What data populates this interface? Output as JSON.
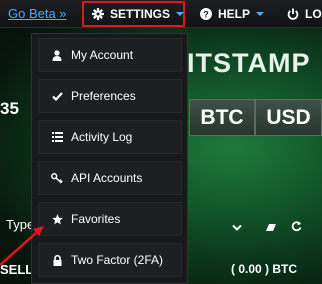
{
  "navbar": {
    "go_beta": "Go Beta »",
    "settings_label": "SETTINGS",
    "help_label": "HELP",
    "logout_label": "LO"
  },
  "settings_menu": {
    "items": [
      {
        "label": "My Account",
        "icon": "user-icon"
      },
      {
        "label": "Preferences",
        "icon": "check-icon"
      },
      {
        "label": "Activity Log",
        "icon": "list-icon"
      },
      {
        "label": "API Accounts",
        "icon": "key-icon"
      },
      {
        "label": "Favorites",
        "icon": "star-icon"
      },
      {
        "label": "Two Factor (2FA)",
        "icon": "lock-icon"
      }
    ]
  },
  "background": {
    "logo_partial": "ITSTAMP",
    "value_partial": "35",
    "currency_btc": "BTC",
    "currency_usd": "USD",
    "type_label": "Type",
    "sell_label": "SELL",
    "balance_value": "( 0.00 )",
    "balance_currency": "BTC"
  },
  "colors": {
    "highlight": "#e3151d",
    "link": "#4fa8ff",
    "arrow": "#e3151d"
  }
}
